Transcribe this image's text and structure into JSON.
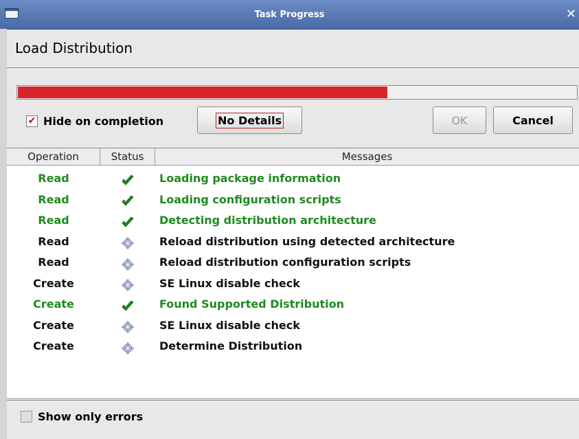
{
  "window": {
    "title": "Task Progress",
    "close_glyph": "✕"
  },
  "page_title": "Load Distribution",
  "progress": {
    "fraction": 0.66,
    "color": "#d9232b"
  },
  "controls": {
    "hide_on_completion": {
      "label": "Hide on completion",
      "checked": true
    },
    "no_details_label": "No Details",
    "ok_label": "OK",
    "cancel_label": "Cancel"
  },
  "table": {
    "headers": [
      "Operation",
      "Status",
      "Messages"
    ],
    "rows": [
      {
        "operation": "Read",
        "status": "check-icon",
        "message": "Loading package information",
        "color": "green"
      },
      {
        "operation": "Read",
        "status": "check-icon",
        "message": "Loading configuration scripts",
        "color": "green"
      },
      {
        "operation": "Read",
        "status": "check-icon",
        "message": "Detecting distribution architecture",
        "color": "green"
      },
      {
        "operation": "Read",
        "status": "gear-icon",
        "message": "Reload distribution using detected architecture",
        "color": "black"
      },
      {
        "operation": "Read",
        "status": "gear-icon",
        "message": "Reload distribution configuration scripts",
        "color": "black"
      },
      {
        "operation": "Create",
        "status": "gear-icon",
        "message": "SE Linux disable check",
        "color": "black"
      },
      {
        "operation": "Create",
        "status": "check-icon",
        "message": "Found Supported Distribution",
        "color": "green"
      },
      {
        "operation": "Create",
        "status": "gear-icon",
        "message": "SE Linux disable check",
        "color": "black"
      },
      {
        "operation": "Create",
        "status": "gear-icon",
        "message": "Determine Distribution",
        "color": "black"
      }
    ]
  },
  "footer": {
    "show_only_errors": {
      "label": "Show only errors",
      "checked": false
    }
  }
}
